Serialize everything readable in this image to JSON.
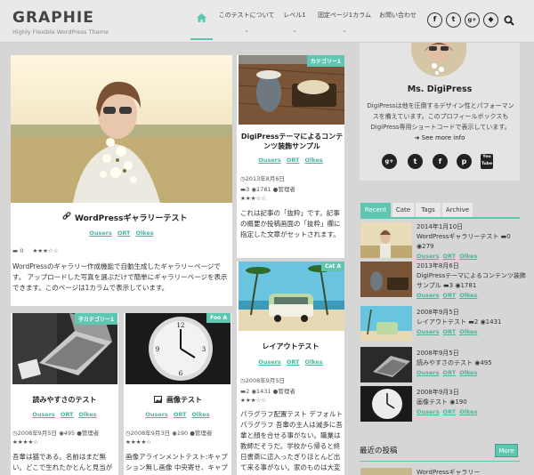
{
  "header": {
    "logo": "GRAPHIE",
    "tagline": "Highly Flexible WordPress Theme",
    "nav": [
      {
        "label": "",
        "chev": ""
      },
      {
        "label": "このテストについて",
        "chev": "⌄"
      },
      {
        "label": "レベル1",
        "chev": "⌄"
      },
      {
        "label": "固定ページ1カラム",
        "chev": "⌄"
      },
      {
        "label": "お問い合わせ",
        "chev": ""
      }
    ],
    "social": [
      "f",
      "t",
      "g+",
      "◆"
    ]
  },
  "posts": {
    "gallery": {
      "title": "WordPressギャラリーテスト",
      "cats": [
        "Ousers",
        "ORT",
        "Olkes"
      ],
      "comments": "0",
      "text": "WordPressのギャラリー作成機能で自動生成したギャラリーページです。 アップロードした写真を選ぶだけで簡単にギャラリーページを表示できます。このページは1カラムで表示しています。"
    },
    "digipress": {
      "tag": "カテゴリー1",
      "title": "DigiPressテーマによるコンテンツ装飾サンプル",
      "cats": [
        "Ousers",
        "ORT",
        "Olkes"
      ],
      "date": "2013年8月6日",
      "comments": "3",
      "views": "1781",
      "author": "管理者",
      "text": "これは記事の「抜粋」です。記事の概要か投稿画面の「抜粋」欄に指定した文章がセットされます。"
    },
    "layout": {
      "tag": "Cat A",
      "title": "レイアウトテスト",
      "cats": [
        "Ousers",
        "ORT",
        "Olkes"
      ],
      "date": "2008年9月5日",
      "comments": "2",
      "views": "1431",
      "author": "管理者",
      "text": "パラグラフ配置テスト デフォルトパラグラフ 吾輩の主人は滅多に吾輩と顔を合せる事がない。職業は教師だそうだ。学校から帰ると終日書斎に這入ったぎりほとんど出て来る事がない。家のものは大変な勉強家だと"
    },
    "readable": {
      "tag": "子カテゴリー1",
      "title": "読みやすさのテスト",
      "cats": [
        "Ousers",
        "ORT",
        "Olkes"
      ],
      "date": "2008年9月5日",
      "views": "495",
      "author": "管理者",
      "text": "吾輩は猫である。名前はまだ無い。どこで生れたかとんと見当がつか"
    },
    "image": {
      "tag": "Foo A",
      "title": "画像テスト",
      "cats": [
        "Ousers",
        "ORT",
        "Olkes"
      ],
      "date": "2008年9月3日",
      "views": "190",
      "author": "管理者",
      "text": "画像アラインメントテスト:キャプション無し画像 中央寄せ、キャプショ"
    }
  },
  "profile": {
    "name": "Ms. DigiPress",
    "text": "DigiPressは他を圧倒するデザイン性とパフォーマンスを備えています。このプロフィールボックスもDigiPress専用ショートコードで表示しています。",
    "more": "See more info",
    "social": [
      "g+",
      "t",
      "f",
      "p",
      "You Tube"
    ]
  },
  "tabs": [
    "Recent",
    "Cate",
    "Tags",
    "Archive"
  ],
  "recent": [
    {
      "date": "2014年1月10日",
      "title": "WordPressギャラリーテスト",
      "comments": "0",
      "views": "279",
      "cats": [
        "Ousers",
        "ORT",
        "Olkes"
      ]
    },
    {
      "date": "2013年8月6日",
      "title": "DigiPressテーマによるコンテンツ装飾サンプル",
      "comments": "3",
      "views": "1781",
      "cats": [
        "Ousers",
        "ORT",
        "Olkes"
      ]
    },
    {
      "date": "2008年9月5日",
      "title": "レイアウトテスト",
      "comments": "2",
      "views": "1431",
      "cats": [
        "Ousers",
        "ORT",
        "Olkes"
      ]
    },
    {
      "date": "2008年9月5日",
      "title": "読みやすさのテスト",
      "comments": "",
      "views": "495",
      "cats": [
        "Ousers",
        "ORT",
        "Olkes"
      ]
    },
    {
      "date": "2008年9月3日",
      "title": "画像テスト",
      "comments": "",
      "views": "190",
      "cats": [
        "Ousers",
        "ORT",
        "Olkes"
      ]
    }
  ],
  "recent_posts": {
    "title": "最近の投稿",
    "more": "More",
    "item": "WordPressギャラリー"
  },
  "colors": {
    "accent": "#5fc6b1"
  }
}
